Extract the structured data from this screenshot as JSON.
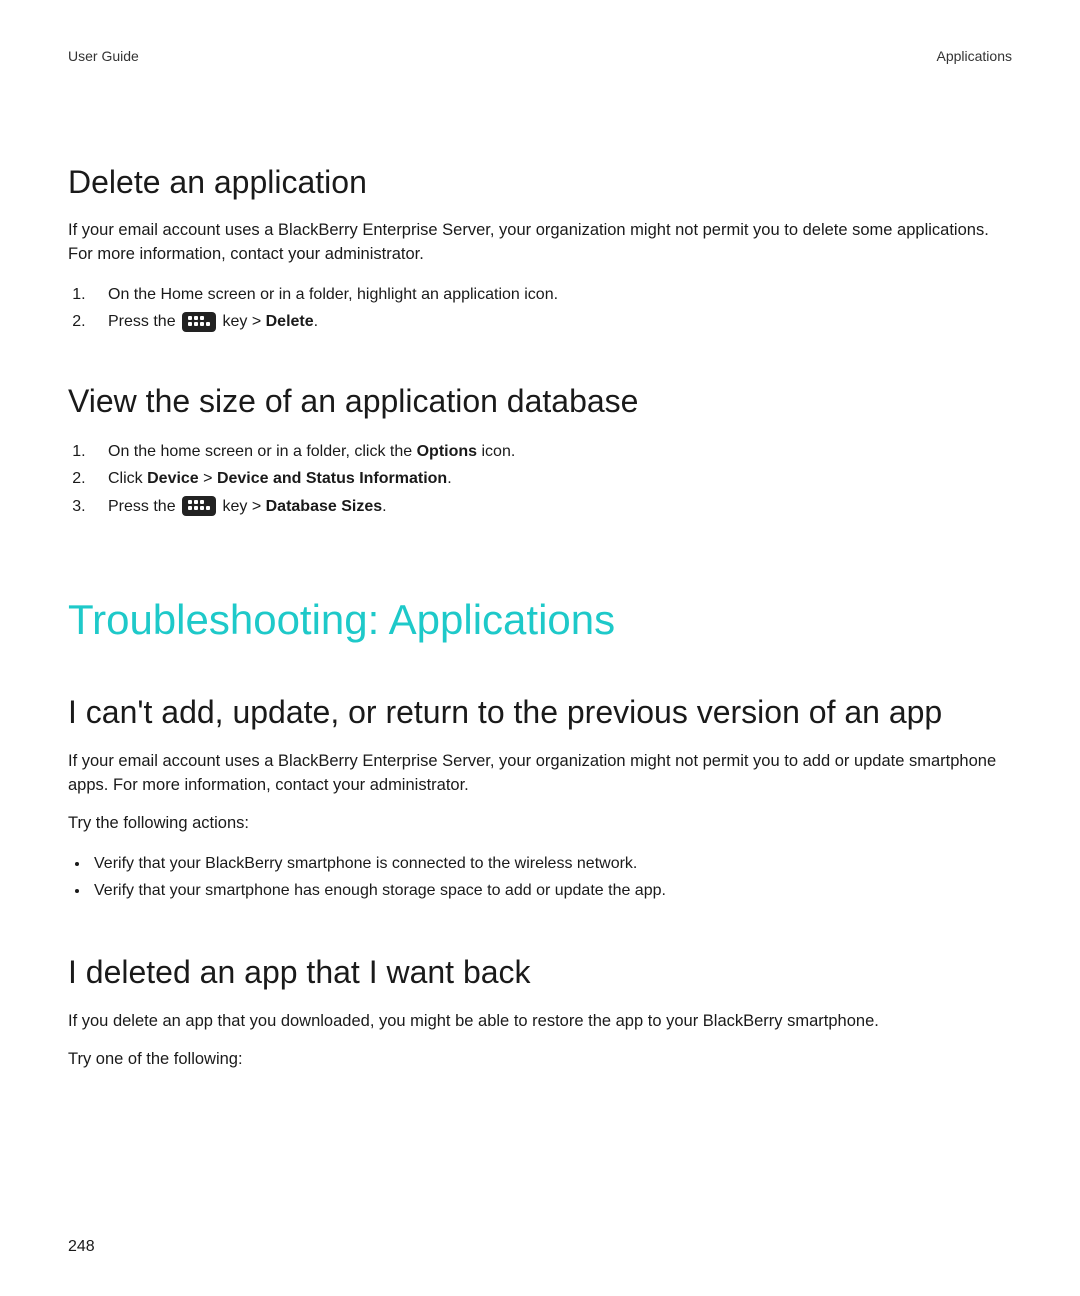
{
  "header": {
    "left": "User Guide",
    "right": "Applications"
  },
  "s1": {
    "title": "Delete an application",
    "intro": "If your email account uses a BlackBerry Enterprise Server, your organization might not permit you to delete some applications. For more information, contact your administrator.",
    "step1": "On the Home screen or in a folder, highlight an application icon.",
    "step2_a": "Press the ",
    "step2_b": " key > ",
    "step2_c": "Delete",
    "step2_d": "."
  },
  "s2": {
    "title": "View the size of an application database",
    "step1_a": "On the home screen or in a folder, click the ",
    "step1_b": "Options",
    "step1_c": " icon.",
    "step2_a": "Click ",
    "step2_b": "Device",
    "step2_c": " > ",
    "step2_d": "Device and Status Information",
    "step2_e": ".",
    "step3_a": "Press the ",
    "step3_b": " key > ",
    "step3_c": "Database Sizes",
    "step3_d": "."
  },
  "ts_title": "Troubleshooting: Applications",
  "s3": {
    "title": "I can't add, update, or return to the previous version of an app",
    "p1": "If your email account uses a BlackBerry Enterprise Server, your organization might not permit you to add or update smartphone apps. For more information, contact your administrator.",
    "p2": "Try the following actions:",
    "b1": "Verify that your BlackBerry smartphone is connected to the wireless network.",
    "b2": "Verify that your smartphone has enough storage space to add or update the app."
  },
  "s4": {
    "title": "I deleted an app that I want back",
    "p1": "If you delete an app that you downloaded, you might be able to restore the app to your BlackBerry smartphone.",
    "p2": "Try one of the following:"
  },
  "page_number": "248"
}
